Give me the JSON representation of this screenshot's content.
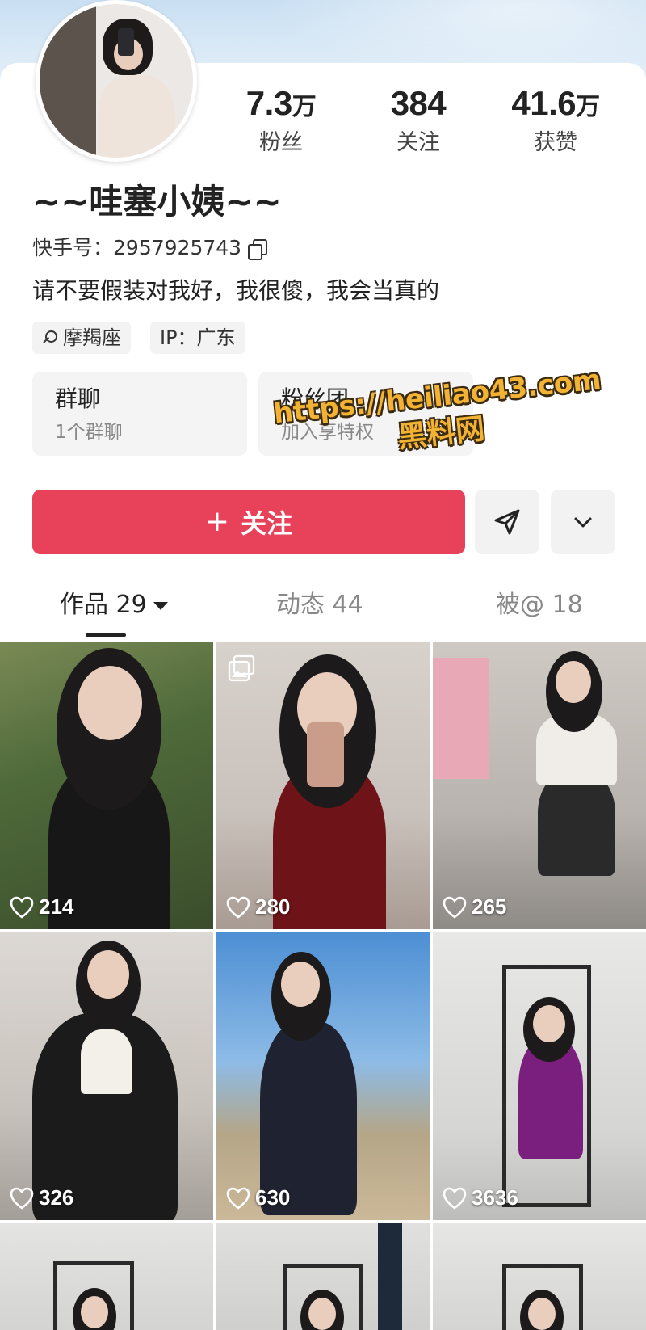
{
  "profile": {
    "nickname": "~~哇塞小姨~~",
    "uid_label": "快手号：",
    "uid": "2957925743",
    "bio": "请不要假装对我好，我很傻，我会当真的",
    "tags": [
      "摩羯座",
      "IP：广东"
    ]
  },
  "stats": [
    {
      "num": "7.3",
      "unit": "万",
      "label": "粉丝"
    },
    {
      "num": "384",
      "unit": "",
      "label": "关注"
    },
    {
      "num": "41.6",
      "unit": "万",
      "label": "获赞"
    }
  ],
  "boxes": [
    {
      "title": "群聊",
      "sub": "1个群聊"
    },
    {
      "title": "粉丝团",
      "sub": "加入享特权"
    }
  ],
  "watermark": {
    "line1": "https://heiliao43.com",
    "line2": "黑料网"
  },
  "actions": {
    "follow_label": "关注",
    "follow_icon": "plus-icon",
    "share_icon": "send-icon",
    "more_icon": "chevron-down-icon"
  },
  "tabs": [
    {
      "label": "作品 29",
      "active": true
    },
    {
      "label": "动态 44",
      "active": false
    },
    {
      "label": "被@ 18",
      "active": false
    }
  ],
  "colors": {
    "accent": "#e8415a",
    "tab_active": "#222222",
    "tab_inactive": "#888888"
  },
  "posts": [
    {
      "likes": "214",
      "multi": false
    },
    {
      "likes": "280",
      "multi": true
    },
    {
      "likes": "265",
      "multi": false
    },
    {
      "likes": "326",
      "multi": false
    },
    {
      "likes": "630",
      "multi": false
    },
    {
      "likes": "3636",
      "multi": false
    },
    {
      "likes": "",
      "multi": false
    },
    {
      "likes": "",
      "multi": false
    },
    {
      "likes": "",
      "multi": false
    }
  ]
}
